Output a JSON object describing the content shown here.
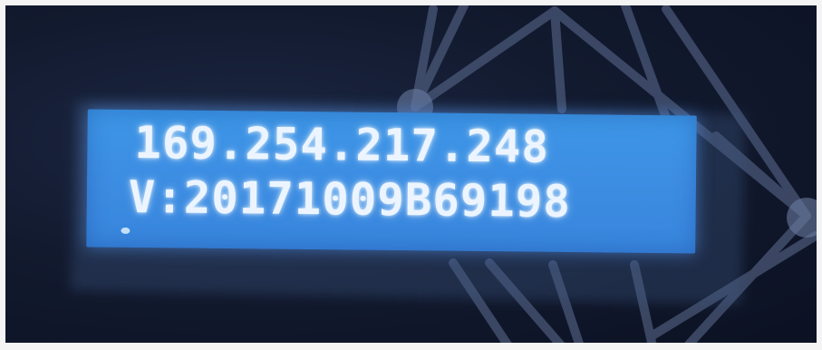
{
  "display": {
    "line1": "169.254.217.248",
    "line2": "V:20171009B69198"
  },
  "colors": {
    "lcd_background": "#3d8fe4",
    "lcd_text": "#ecf5ff",
    "scene_background": "#121a2f"
  }
}
